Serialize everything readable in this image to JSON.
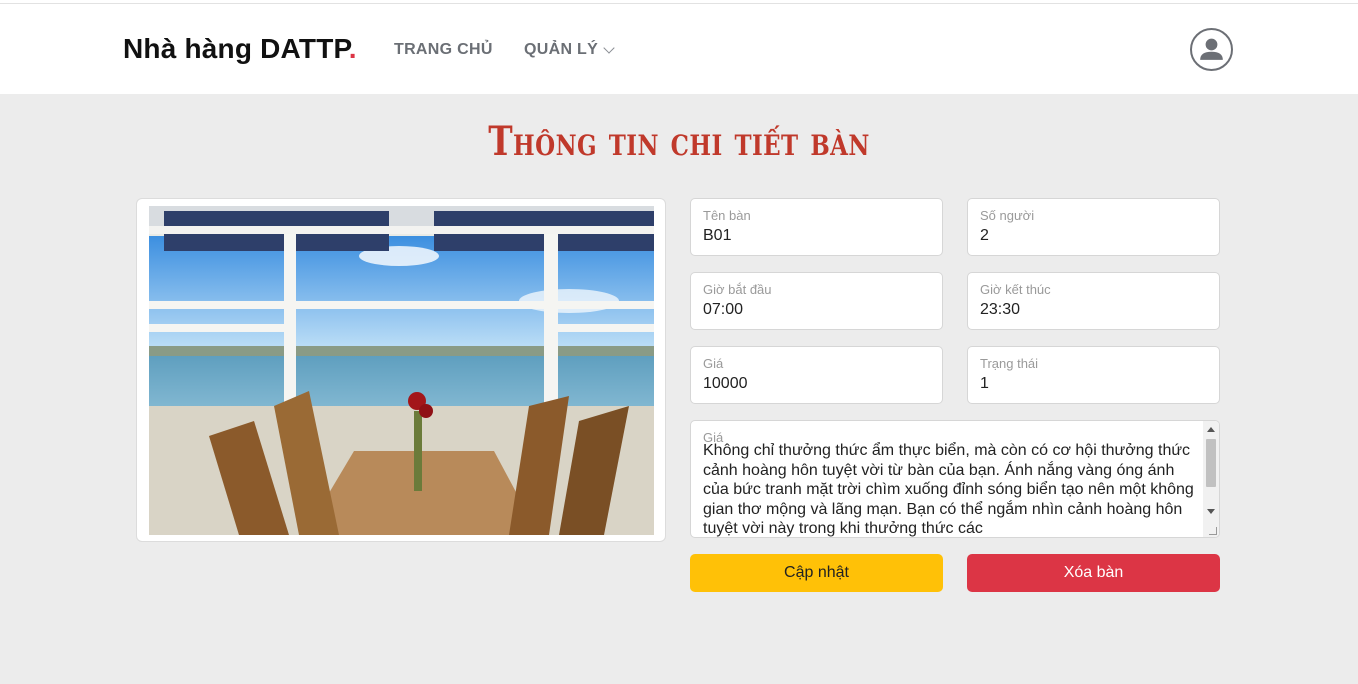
{
  "brand": {
    "name": "Nhà hàng DATTP",
    "dot": "."
  },
  "nav": {
    "home": "TRANG CHỦ",
    "manage": "QUẢN LÝ"
  },
  "icons": {
    "user": "user-avatar-icon",
    "chevron": "chevron-down-icon"
  },
  "page": {
    "title": "Thông tin chi tiết bàn"
  },
  "form": {
    "table_name": {
      "label": "Tên bàn",
      "value": "B01"
    },
    "people": {
      "label": "Số người",
      "value": "2"
    },
    "start_time": {
      "label": "Giờ bắt đầu",
      "value": "07:00"
    },
    "end_time": {
      "label": "Giờ kết thúc",
      "value": "23:30"
    },
    "price": {
      "label": "Giá",
      "value": "10000"
    },
    "status": {
      "label": "Trạng thái",
      "value": "1"
    },
    "description": {
      "label": "Giá",
      "value": "Không chỉ thưởng thức ẩm thực biển, mà còn có cơ hội thưởng thức cảnh hoàng hôn tuyệt vời từ bàn của bạn. Ánh nắng vàng óng ánh của bức tranh mặt trời chìm xuống đỉnh sóng biển tạo nên một không gian thơ mộng và lãng mạn. Bạn có thể ngắm nhìn cảnh hoàng hôn tuyệt vời này trong khi thưởng thức các"
    }
  },
  "buttons": {
    "update": "Cập nhật",
    "delete": "Xóa bàn"
  },
  "colors": {
    "accent_red": "#dc3545",
    "title_red": "#c0392b",
    "update_yellow": "#ffc107"
  }
}
